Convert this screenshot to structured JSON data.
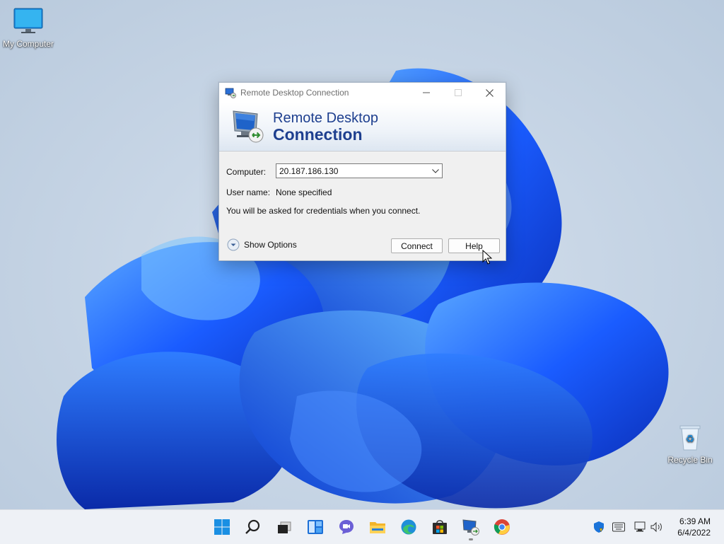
{
  "desktop": {
    "icons": [
      {
        "label": "My Computer",
        "icon": "monitor-icon"
      },
      {
        "label": "Recycle Bin",
        "icon": "recycle-bin-icon"
      }
    ]
  },
  "window": {
    "title": "Remote Desktop Connection",
    "banner_line1": "Remote Desktop",
    "banner_line2": "Connection",
    "computer_label": "Computer:",
    "computer_value": "20.187.186.130",
    "username_label": "User name:",
    "username_value": "None specified",
    "note": "You will be asked for credentials when you connect.",
    "show_options": "Show Options",
    "connect_label": "Connect",
    "help_label": "Help",
    "colors": {
      "banner_text": "#1e3f8f"
    }
  },
  "taskbar": {
    "apps": [
      "start-icon",
      "search-icon",
      "task-view-icon",
      "widgets-icon",
      "chat-icon",
      "file-explorer-icon",
      "edge-icon",
      "store-icon",
      "remote-desktop-icon",
      "chrome-icon"
    ],
    "tray_icons": [
      "security-icon",
      "keyboard-icon",
      "network-icon",
      "volume-icon"
    ],
    "time": "6:39 AM",
    "date": "6/4/2022"
  }
}
